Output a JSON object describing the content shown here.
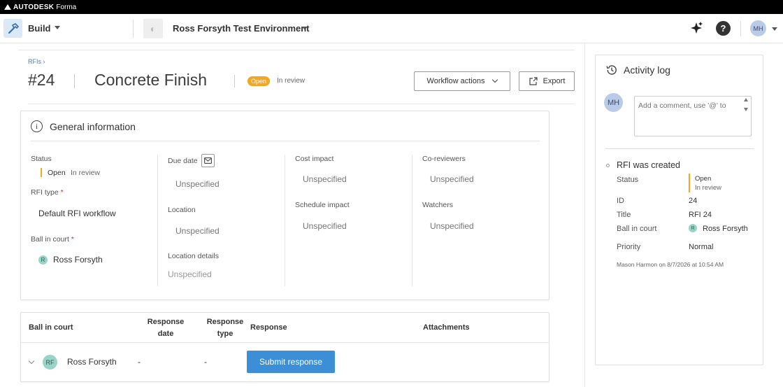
{
  "brand": {
    "name": "AUTODESK",
    "product": "Forma"
  },
  "header": {
    "module": "Build",
    "project": "Ross Forsyth Test Environment",
    "user_initials": "MH",
    "help": "?"
  },
  "rfi": {
    "breadcrumb": "RFIs ›",
    "number": "#24",
    "title": "Concrete Finish",
    "status": "Open",
    "substatus": "In review",
    "workflow_button": "Workflow actions",
    "export_button": "Export"
  },
  "general": {
    "title": "General information",
    "status_label": "Status",
    "status_value": "Open",
    "status_sub": "In review",
    "rfi_type_label": "RFI type",
    "rfi_type_value": "Default RFI workflow",
    "ball_label": "Ball in court",
    "ball_value": "Ross Forsyth",
    "ball_initial": "R",
    "due_label": "Due date",
    "due_value": "Unspecified",
    "location_label": "Location",
    "location_value": "Unspecified",
    "location_details_label": "Location details",
    "location_details_value": "Unspecified",
    "cost_label": "Cost impact",
    "cost_value": "Unspecified",
    "schedule_label": "Schedule impact",
    "schedule_value": "Unspecified",
    "coreviewers_label": "Co-reviewers",
    "coreviewers_value": "Unspecified",
    "watchers_label": "Watchers",
    "watchers_value": "Unspecified",
    "required_mark": "*"
  },
  "responses": {
    "headers": {
      "ball": "Ball in court",
      "resp_date_1": "Response",
      "resp_date_2": "date",
      "resp_type_1": "Response",
      "resp_type_2": "type",
      "response": "Response",
      "attachments": "Attachments"
    },
    "row": {
      "initials": "RF",
      "name": "Ross Forsyth",
      "date": "-",
      "type": "-",
      "submit": "Submit response"
    }
  },
  "activity": {
    "title": "Activity log",
    "avatar": "MH",
    "comment_placeholder": "Add a comment, use '@' to",
    "event": {
      "title": "RFI was created",
      "status_label": "Status",
      "status_value": "Open",
      "status_sub": "In review",
      "id_label": "ID",
      "id_value": "24",
      "title_label": "Title",
      "title_value": "RFI 24",
      "ball_label": "Ball in court",
      "ball_initial": "R",
      "ball_value": "Ross Forsyth",
      "priority_label": "Priority",
      "priority_value": "Normal",
      "meta": "Mason Harmon on 8/7/2026 at 10:54 AM"
    }
  },
  "colors": {
    "accent": "#3c8fd6",
    "status_open": "#f5a623",
    "avatar": "#9ad3c8"
  }
}
